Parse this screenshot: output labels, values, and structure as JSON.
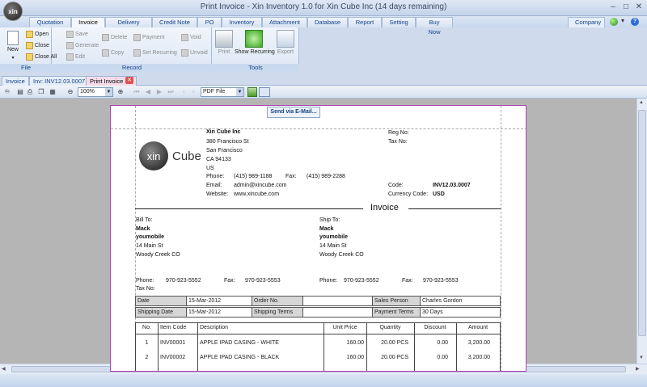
{
  "app": {
    "title": "Print Invoice - Xin Inventory 1.0 for Xin Cube Inc (14 days remaining)",
    "logo_text": "xin"
  },
  "window_controls": {
    "minimize": "–",
    "maximize": "□",
    "close": "✕"
  },
  "menu": {
    "tabs": [
      "Quotation",
      "Invoice",
      "Delivery Note",
      "Credit Note",
      "PO",
      "Inventory",
      "Attachment",
      "Database",
      "Report",
      "Setting",
      "Buy Now"
    ],
    "active": "Invoice",
    "company": "Company"
  },
  "ribbon": {
    "file": {
      "label": "File",
      "new": "New",
      "open": "Open",
      "close": "Close",
      "close_all": "Close All"
    },
    "record": {
      "label": "Record",
      "save": "Save",
      "generate": "Generate",
      "edit": "Edit",
      "delete": "Delete",
      "copy": "Copy",
      "payment": "Payment",
      "set_recurring": "Set Recurring",
      "void": "Void",
      "unvoid": "Unvoid"
    },
    "tools": {
      "label": "Tools",
      "print": "Print",
      "show_recurring": "Show Recurring",
      "export": "Export"
    }
  },
  "doc_tabs": [
    "Invoice",
    "Inv: INV12.03.0007",
    "Print Invoice"
  ],
  "viewer_toolbar": {
    "zoom": "100%",
    "format": "PDF File"
  },
  "tooltip": "Send via E-Mail...",
  "invoice": {
    "logo_text": "xin",
    "logo_word": "Cube",
    "company": {
      "name": "Xin Cube Inc",
      "address1": "380 Francisco St",
      "city": "San Francisco",
      "state_zip": "CA 94133",
      "country": "US"
    },
    "phone_label": "Phone:",
    "phone": "(415) 989-1188",
    "fax_label": "Fax:",
    "fax": "(415) 989-2288",
    "email_label": "Email:",
    "email": "admin@xincube.com",
    "website_label": "Website:",
    "website": "www.xincube.com",
    "reg_label": "Reg No:",
    "tax_label": "Tax No:",
    "code_label": "Code:",
    "code": "INV12.03.0007",
    "currency_label": "Currency Code:",
    "currency": "USD",
    "heading": "Invoice",
    "bill_to": {
      "label": "Bill To:",
      "name": "Mack",
      "org": "youmobile",
      "address": "14 Main St",
      "city": "Woody Creek CO",
      "phone": "970-923-5552",
      "fax": "970-923-5553"
    },
    "ship_to": {
      "label": "Ship To:",
      "name": "Mack",
      "org": "youmobile",
      "address": "14 Main St",
      "city": "Woody Creek CO",
      "phone": "970-923-5552",
      "fax": "970-923-5553"
    },
    "tax_no_label": "Tax No:",
    "info": {
      "date_label": "Date",
      "date": "15-Mar-2012",
      "order_label": "Order No.",
      "order": "",
      "sales_label": "Sales Person",
      "sales": "Charles Gordon",
      "ship_date_label": "Shipping Date",
      "ship_date": "15-Mar-2012",
      "ship_terms_label": "Shipping Terms",
      "ship_terms": "",
      "pay_terms_label": "Payment Terms",
      "pay_terms": "30 Days"
    },
    "items_headers": [
      "No.",
      "Item Code",
      "Description",
      "Unit Price",
      "Quantity",
      "Discount",
      "Amount"
    ],
    "items": [
      {
        "no": "1",
        "code": "INV00001",
        "desc": "APPLE IPAD CASING - WHITE",
        "price": "160.00",
        "qty": "20.00 PCS",
        "disc": "0.00",
        "amount": "3,200.00"
      },
      {
        "no": "2",
        "code": "INV00002",
        "desc": "APPLE IPAD CASING - BLACK",
        "price": "160.00",
        "qty": "20.00 PCS",
        "disc": "0.00",
        "amount": "3,200.00"
      }
    ]
  }
}
